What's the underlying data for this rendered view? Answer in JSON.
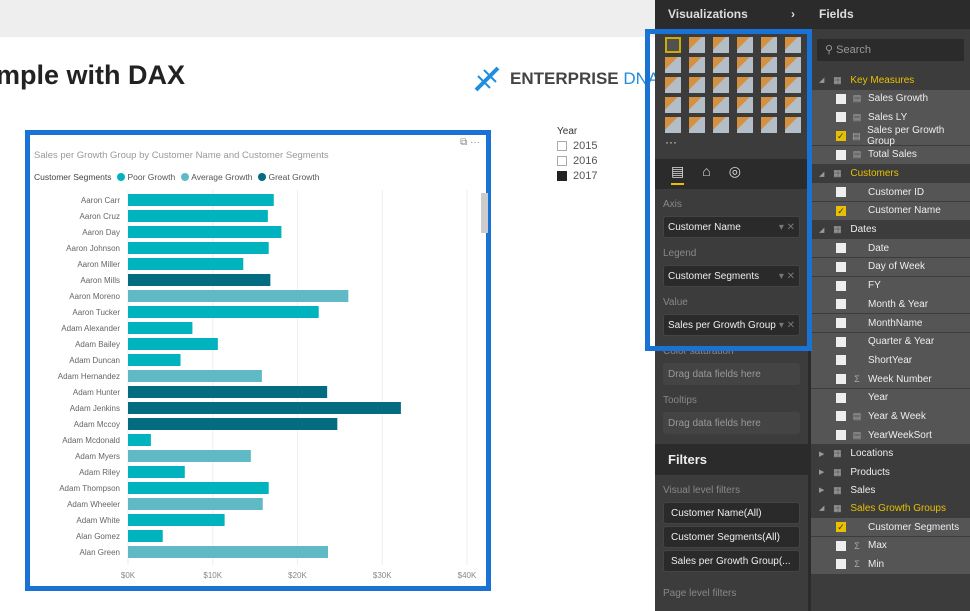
{
  "report": {
    "title": "mple with DAX",
    "logo_text": "ENTERPRISE",
    "logo_accent": "DNA"
  },
  "slicer": {
    "label": "Year",
    "items": [
      {
        "label": "2015",
        "checked": false
      },
      {
        "label": "2016",
        "checked": false
      },
      {
        "label": "2017",
        "checked": true
      }
    ]
  },
  "visual": {
    "more": "···"
  },
  "chart_data": {
    "type": "bar",
    "orientation": "horizontal",
    "title": "Sales per Growth Group by Customer Name and Customer Segments",
    "legend_title": "Customer Segments",
    "legend_position": "top-left",
    "series": [
      {
        "name": "Poor Growth",
        "color": "#01B3BE"
      },
      {
        "name": "Average Growth",
        "color": "#5FBAC6"
      },
      {
        "name": "Great Growth",
        "color": "#046C80"
      }
    ],
    "xlim": [
      0,
      40000
    ],
    "xticks": [
      "$0K",
      "$10K",
      "$20K",
      "$30K",
      "$40K"
    ],
    "grid": true,
    "categories": [
      "Aaron Carr",
      "Aaron Cruz",
      "Aaron Day",
      "Aaron Johnson",
      "Aaron Miller",
      "Aaron Mills",
      "Aaron Moreno",
      "Aaron Tucker",
      "Adam Alexander",
      "Adam Bailey",
      "Adam Duncan",
      "Adam Hernandez",
      "Adam Hunter",
      "Adam Jenkins",
      "Adam Mccoy",
      "Adam Mcdonald",
      "Adam Myers",
      "Adam Riley",
      "Adam Thompson",
      "Adam Wheeler",
      "Adam White",
      "Alan Gomez",
      "Alan Green"
    ],
    "values": [
      17200,
      16500,
      18100,
      16600,
      13600,
      16800,
      26000,
      22500,
      7600,
      10600,
      6200,
      15800,
      23500,
      32200,
      24700,
      2700,
      14500,
      6700,
      16600,
      15900,
      11400,
      4100,
      23600
    ],
    "segments": [
      "Poor Growth",
      "Poor Growth",
      "Poor Growth",
      "Poor Growth",
      "Poor Growth",
      "Great Growth",
      "Average Growth",
      "Poor Growth",
      "Poor Growth",
      "Poor Growth",
      "Poor Growth",
      "Average Growth",
      "Great Growth",
      "Great Growth",
      "Great Growth",
      "Poor Growth",
      "Average Growth",
      "Poor Growth",
      "Poor Growth",
      "Average Growth",
      "Poor Growth",
      "Poor Growth",
      "Average Growth"
    ]
  },
  "viz_pane": {
    "title": "Visualizations",
    "expand": "›",
    "more": "···",
    "wells": [
      {
        "label": "Axis",
        "value": "Customer Name"
      },
      {
        "label": "Legend",
        "value": "Customer Segments"
      },
      {
        "label": "Value",
        "value": "Sales per Growth Group"
      },
      {
        "label": "Color saturation",
        "value": "Drag data fields here"
      },
      {
        "label": "Tooltips",
        "value": "Drag data fields here"
      }
    ],
    "filters_title": "Filters",
    "visual_filters_label": "Visual level filters",
    "visual_filters": [
      "Customer Name(All)",
      "Customer Segments(All)",
      "Sales per Growth Group(..."
    ],
    "page_filters_label": "Page level filters"
  },
  "fields_pane": {
    "title": "Fields",
    "search_placeholder": "Search",
    "rows": [
      {
        "t": "table",
        "label": "Key Measures",
        "active": true
      },
      {
        "t": "field",
        "label": "Sales Growth",
        "icon": "calc"
      },
      {
        "t": "field",
        "label": "Sales LY",
        "icon": "calc"
      },
      {
        "t": "field",
        "label": "Sales per Growth Group",
        "icon": "calc",
        "checked": true
      },
      {
        "t": "field",
        "label": "Total Sales",
        "icon": "calc"
      },
      {
        "t": "table",
        "label": "Customers",
        "active": true
      },
      {
        "t": "field",
        "label": "Customer ID"
      },
      {
        "t": "field",
        "label": "Customer Name",
        "checked": true
      },
      {
        "t": "table",
        "label": "Dates"
      },
      {
        "t": "field",
        "label": "Date"
      },
      {
        "t": "field",
        "label": "Day of Week"
      },
      {
        "t": "field",
        "label": "FY"
      },
      {
        "t": "field",
        "label": "Month & Year"
      },
      {
        "t": "field",
        "label": "MonthName"
      },
      {
        "t": "field",
        "label": "Quarter & Year"
      },
      {
        "t": "field",
        "label": "ShortYear"
      },
      {
        "t": "field",
        "label": "Week Number",
        "icon": "sigma"
      },
      {
        "t": "field",
        "label": "Year"
      },
      {
        "t": "field",
        "label": "Year & Week",
        "icon": "calc"
      },
      {
        "t": "field",
        "label": "YearWeekSort",
        "icon": "calc"
      },
      {
        "t": "table",
        "label": "Locations",
        "collapsed": true
      },
      {
        "t": "table",
        "label": "Products",
        "collapsed": true
      },
      {
        "t": "table",
        "label": "Sales",
        "collapsed": true
      },
      {
        "t": "table",
        "label": "Sales Growth Groups",
        "active": true
      },
      {
        "t": "field",
        "label": "Customer Segments",
        "checked": true
      },
      {
        "t": "field",
        "label": "Max",
        "icon": "sigma"
      },
      {
        "t": "field",
        "label": "Min",
        "icon": "sigma"
      }
    ]
  }
}
